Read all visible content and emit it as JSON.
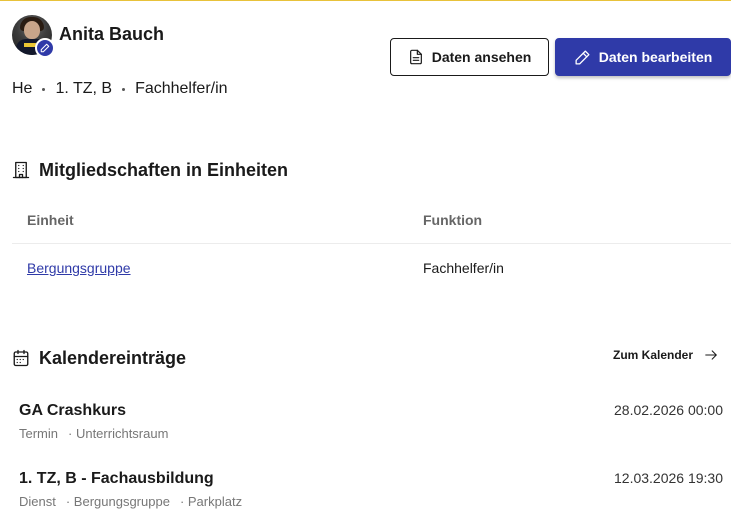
{
  "profile": {
    "name": "Anita Bauch",
    "meta": [
      "He",
      "1. TZ, B",
      "Fachhelfer/in"
    ]
  },
  "actions": {
    "view_label": "Daten ansehen",
    "edit_label": "Daten bearbeiten"
  },
  "memberships": {
    "title": "Mitgliedschaften in Einheiten",
    "columns": [
      "Einheit",
      "Funktion"
    ],
    "rows": [
      {
        "unit": "Bergungsgruppe",
        "function": "Fachhelfer/in"
      }
    ]
  },
  "calendar": {
    "title": "Kalendereinträge",
    "link_label": "Zum Kalender",
    "events": [
      {
        "title": "GA Crashkurs",
        "date": "28.02.2026 00:00",
        "details": [
          "Termin",
          "· Unterrichtsraum"
        ]
      },
      {
        "title": "1. TZ, B - Fachausbildung",
        "date": "12.03.2026 19:30",
        "details": [
          "Dienst",
          "· Bergungsgruppe",
          "· Parkplatz"
        ]
      }
    ]
  },
  "colors": {
    "primary": "#2f3aa8",
    "accent_top": "#e8c23a",
    "link": "#2f3aa8"
  }
}
